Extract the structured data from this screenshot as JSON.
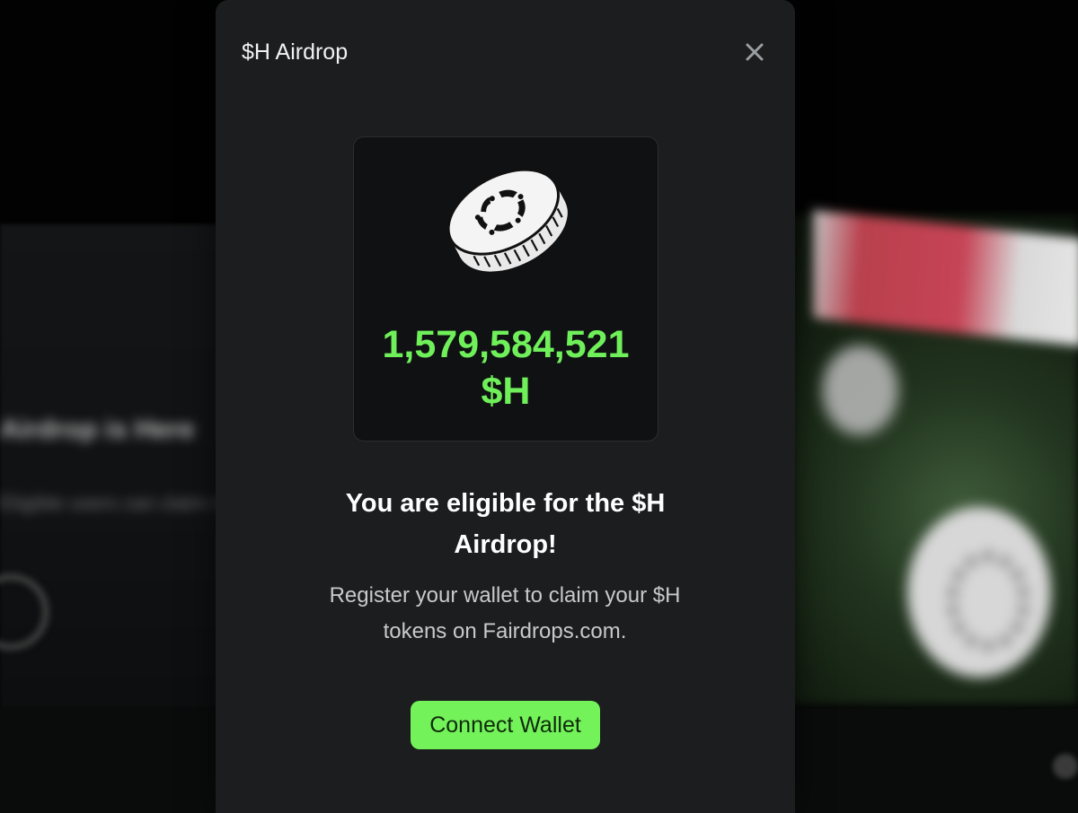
{
  "background": {
    "left_heading": "Airdrop is Here",
    "left_subtext": "Eligible users can claim now"
  },
  "modal": {
    "title": "$H Airdrop",
    "close_icon": "close-icon",
    "coin_icon": "coin-icon",
    "amount_value": "1,579,584,521",
    "amount_unit": "$H",
    "eligible_line1": "You are eligible for the $H",
    "eligible_line2": "Airdrop!",
    "register_line1": "Register your wallet to claim your $H",
    "register_line2": "tokens on Fairdrops.com.",
    "connect_button_label": "Connect Wallet"
  },
  "colors": {
    "modal_bg": "#1b1d1e",
    "card_bg": "#101112",
    "accent_green": "#74f25a",
    "amount_green": "#6ff05a"
  }
}
